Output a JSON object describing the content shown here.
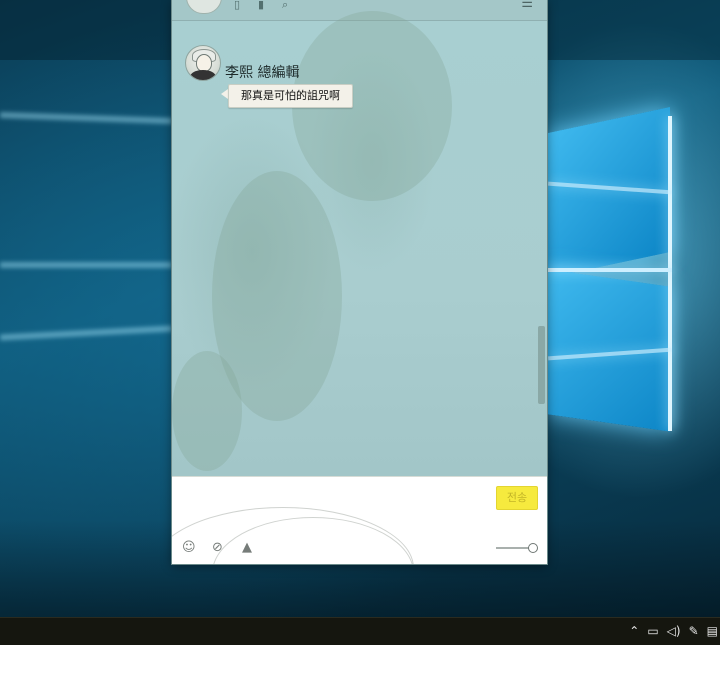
{
  "chat": {
    "sender_name": "李熙  總編輯",
    "message_text": "那真是可怕的詛咒啊",
    "send_label": "전송",
    "menu_icon": "☰"
  },
  "toolbar_icons": [
    "emoji-icon",
    "attach-icon",
    "image-icon"
  ],
  "tray_icons": [
    "chevron-up-icon",
    "network-icon",
    "volume-icon",
    "pen-icon",
    "keyboard-icon"
  ],
  "colors": {
    "send_button": "#f6ea3e",
    "chat_background": "#a8cfd1",
    "taskbar": "#15160f"
  }
}
